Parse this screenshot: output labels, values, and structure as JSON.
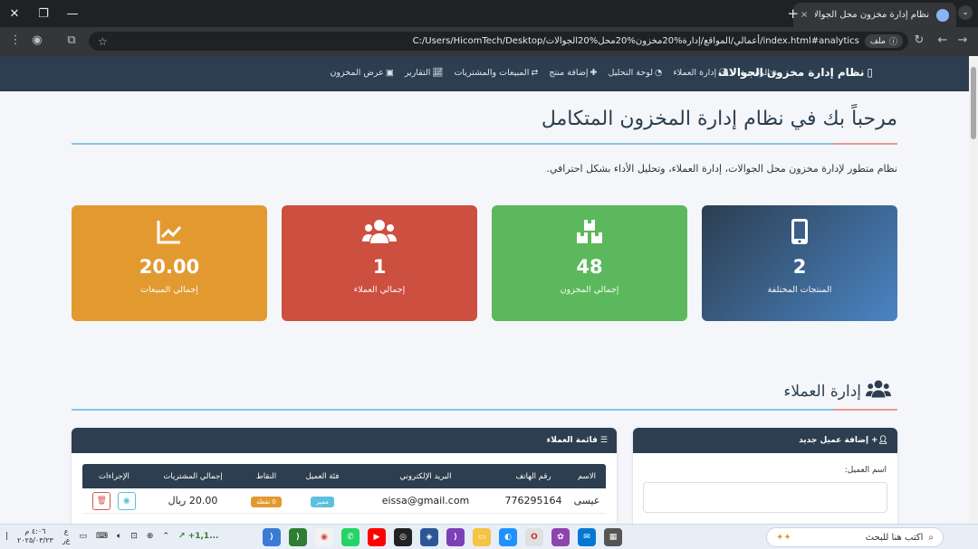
{
  "browser": {
    "tab_title": "نظام إدارة مخزون محل الجوالات",
    "tab_close": "×",
    "new_tab": "+",
    "url": "C:/Users/HicomTech/Desktop/أعمالي/المواقع/إدارة%20مخزون%20محل%20الجوالات/index.html#analytics",
    "site_chip": "ملف"
  },
  "navbar": {
    "brand": "نظام إدارة مخزون الجوالات",
    "links": [
      {
        "label": "الرئيسية",
        "icon": "home-icon"
      },
      {
        "label": "إدارة العملاء",
        "icon": "users-icon"
      },
      {
        "label": "لوحة التحليل",
        "icon": "chart-pie-icon"
      },
      {
        "label": "إضافة منتج",
        "icon": "plus-icon"
      },
      {
        "label": "المبيعات والمشتريات",
        "icon": "exchange-icon"
      },
      {
        "label": "التقارير",
        "icon": "line-chart-icon"
      },
      {
        "label": "عرض المخزون",
        "icon": "boxes-icon"
      }
    ]
  },
  "hero": {
    "title": "مرحباً بك في نظام إدارة المخزون المتكامل",
    "intro": "نظام متطور لإدارة مخزون محل الجوالات، إدارة العملاء، وتحليل الأداء بشكل احترافي."
  },
  "stats": [
    {
      "value": "2",
      "label": "المنتجات المختلفة",
      "icon": "mobile-icon",
      "color": "#2c3e50"
    },
    {
      "value": "48",
      "label": "إجمالي المخزون",
      "icon": "boxes-icon",
      "color": "#5cb85c"
    },
    {
      "value": "1",
      "label": "إجمالي العملاء",
      "icon": "users-icon",
      "color": "#cd4f40"
    },
    {
      "value": "20.00",
      "label": "إجمالي المبيعات",
      "icon": "chart-line-icon",
      "color": "#e29a30"
    }
  ],
  "customers": {
    "section_title": "إدارة العملاء",
    "add_panel_title": "إضافة عميل جديد",
    "name_label": "اسم العميل:",
    "list_panel_title": "قائمة العملاء",
    "columns": [
      "الاسم",
      "رقم الهاتف",
      "البريد الإلكتروني",
      "فئة العميل",
      "النقاط",
      "إجمالي المشتريات",
      "الإجراءات"
    ],
    "rows": [
      {
        "name": "عيسى",
        "phone": "776295164",
        "email": "eissa@gmail.com",
        "category": "مميز",
        "points": "0 نقطة",
        "total": "20.00 ريال"
      }
    ]
  },
  "taskbar": {
    "search_placeholder": "اكتب هنا للبحث",
    "time": "٤:٠٦ م",
    "date": "٢٠٢٥/٠٣/٢٣",
    "stock": "+1,1...",
    "lang": "ع",
    "lang2": "ﻉﺭ"
  }
}
